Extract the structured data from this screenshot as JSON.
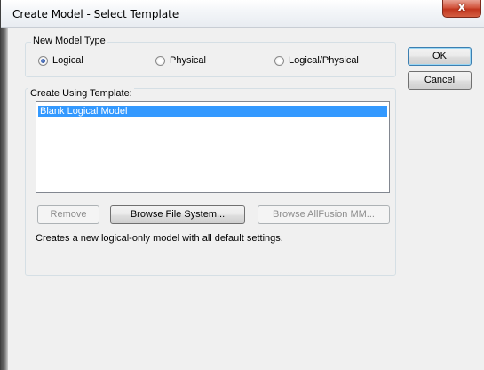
{
  "window": {
    "title": "Create Model - Select Template",
    "close_glyph": "x"
  },
  "model_type": {
    "legend": "New Model Type",
    "options": [
      {
        "label": "Logical",
        "selected": true
      },
      {
        "label": "Physical",
        "selected": false
      },
      {
        "label": "Logical/Physical",
        "selected": false
      }
    ]
  },
  "template": {
    "legend": "Create Using Template:",
    "items": [
      {
        "label": "Blank Logical Model",
        "selected": true
      }
    ],
    "buttons": {
      "remove": "Remove",
      "browse_file_system": "Browse File System...",
      "browse_allfusion": "Browse AllFusion MM..."
    },
    "description": "Creates a new logical-only model with all default settings."
  },
  "actions": {
    "ok": "OK",
    "cancel": "Cancel"
  },
  "colors": {
    "selection": "#3399ff",
    "close_button": "#c1361f",
    "default_button_border": "#3c7fb1"
  }
}
